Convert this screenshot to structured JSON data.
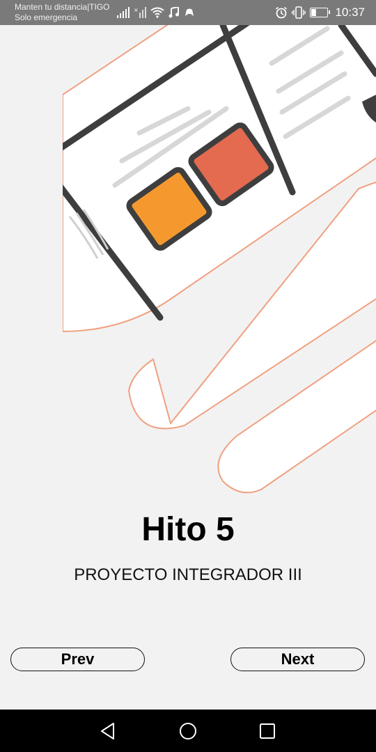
{
  "status_bar": {
    "carrier_line1": "Manten tu distancia|TIGO",
    "carrier_line2": "Solo emergencia",
    "battery_level": "34",
    "time": "10:37",
    "icons": [
      "signal-icon",
      "signal-off-icon",
      "wifi-icon",
      "music-icon",
      "game-icon",
      "alarm-icon",
      "vibrate-icon",
      "battery-icon"
    ]
  },
  "main": {
    "title": "Hito 5",
    "subtitle": "PROYECTO INTEGRADOR III"
  },
  "nav_buttons": {
    "prev_label": "Prev",
    "next_label": "Next"
  },
  "system_nav": {
    "icons": [
      "back-icon",
      "home-icon",
      "recents-icon"
    ]
  },
  "colors": {
    "background": "#f2f2f2",
    "accent_outline": "#f0a080",
    "orange_square": "#f5992f",
    "red_square": "#e46a50",
    "status_bar": "#7a7a7a"
  }
}
